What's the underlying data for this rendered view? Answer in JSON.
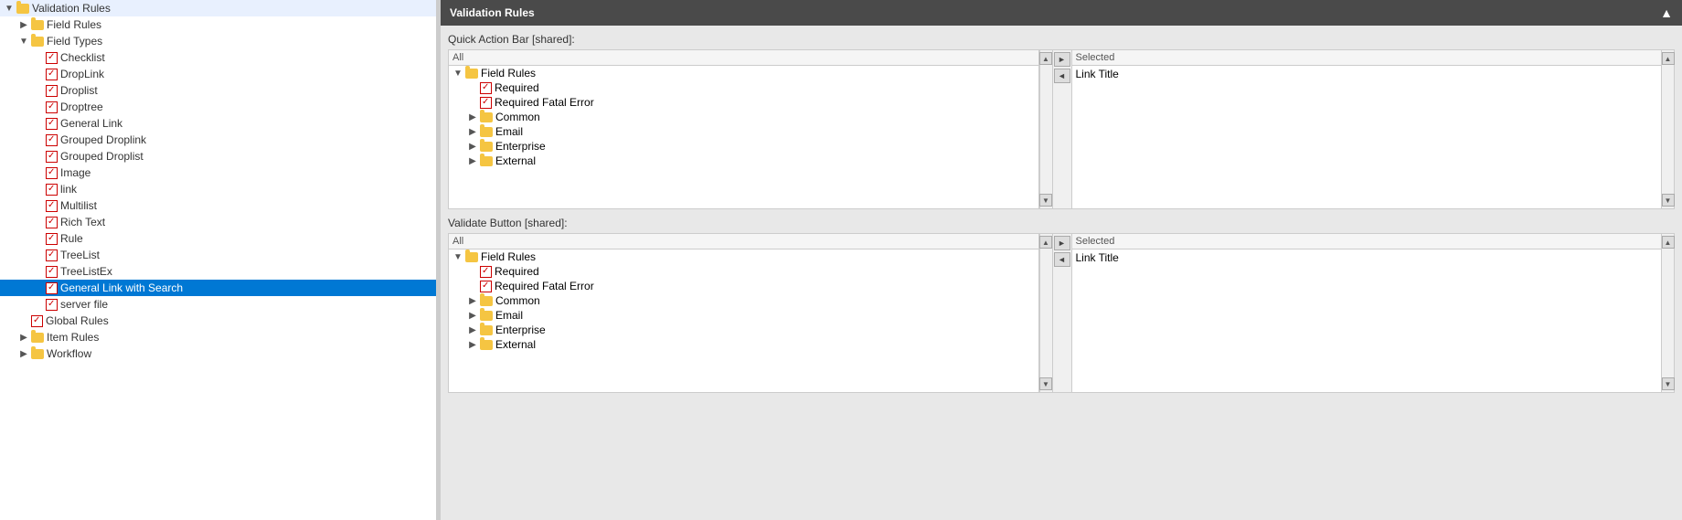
{
  "sidebar": {
    "title": "Validation Rules",
    "items": [
      {
        "id": "validation-rules",
        "label": "Validation Rules",
        "type": "folder",
        "level": 0,
        "expanded": true,
        "arrow": "open"
      },
      {
        "id": "field-rules",
        "label": "Field Rules",
        "type": "folder",
        "level": 1,
        "expanded": false,
        "arrow": "closed"
      },
      {
        "id": "field-types",
        "label": "Field Types",
        "type": "folder",
        "level": 1,
        "expanded": true,
        "arrow": "open"
      },
      {
        "id": "checklist",
        "label": "Checklist",
        "type": "rule",
        "level": 2,
        "arrow": "leaf"
      },
      {
        "id": "droplink",
        "label": "DropLink",
        "type": "rule",
        "level": 2,
        "arrow": "leaf"
      },
      {
        "id": "droplist",
        "label": "Droplist",
        "type": "rule",
        "level": 2,
        "arrow": "leaf"
      },
      {
        "id": "droptree",
        "label": "Droptree",
        "type": "rule",
        "level": 2,
        "arrow": "leaf"
      },
      {
        "id": "general-link",
        "label": "General Link",
        "type": "rule",
        "level": 2,
        "arrow": "leaf"
      },
      {
        "id": "grouped-droplink",
        "label": "Grouped Droplink",
        "type": "rule",
        "level": 2,
        "arrow": "leaf"
      },
      {
        "id": "grouped-droplist",
        "label": "Grouped Droplist",
        "type": "rule",
        "level": 2,
        "arrow": "leaf"
      },
      {
        "id": "image",
        "label": "Image",
        "type": "rule",
        "level": 2,
        "arrow": "leaf"
      },
      {
        "id": "link",
        "label": "link",
        "type": "rule",
        "level": 2,
        "arrow": "leaf"
      },
      {
        "id": "multilist",
        "label": "Multilist",
        "type": "rule",
        "level": 2,
        "arrow": "leaf"
      },
      {
        "id": "rich-text",
        "label": "Rich Text",
        "type": "rule",
        "level": 2,
        "arrow": "leaf"
      },
      {
        "id": "rule",
        "label": "Rule",
        "type": "rule",
        "level": 2,
        "arrow": "leaf"
      },
      {
        "id": "treelist",
        "label": "TreeList",
        "type": "rule",
        "level": 2,
        "arrow": "leaf"
      },
      {
        "id": "treelistex",
        "label": "TreeListEx",
        "type": "rule",
        "level": 2,
        "arrow": "leaf"
      },
      {
        "id": "general-link-search",
        "label": "General Link with Search",
        "type": "rule",
        "level": 2,
        "arrow": "leaf",
        "selected": true
      },
      {
        "id": "server-file",
        "label": "server file",
        "type": "rule",
        "level": 2,
        "arrow": "leaf"
      },
      {
        "id": "global-rules",
        "label": "Global Rules",
        "type": "rule",
        "level": 1,
        "arrow": "leaf"
      },
      {
        "id": "item-rules",
        "label": "Item Rules",
        "type": "folder",
        "level": 1,
        "expanded": false,
        "arrow": "closed"
      },
      {
        "id": "workflow",
        "label": "Workflow",
        "type": "folder",
        "level": 1,
        "expanded": false,
        "arrow": "closed"
      }
    ]
  },
  "panel": {
    "title": "Validation Rules",
    "collapse_label": "▲",
    "sections": [
      {
        "id": "quick-action-bar",
        "label": "Quick Action Bar",
        "shared": "[shared]:",
        "all_header": "All",
        "selected_header": "Selected",
        "selected_items": [
          "Link Title"
        ],
        "tree": {
          "items": [
            {
              "id": "field-rules-all-1",
              "label": "Field Rules",
              "type": "folder",
              "level": 0,
              "expanded": true
            },
            {
              "id": "required-1",
              "label": "Required",
              "type": "rule",
              "level": 1
            },
            {
              "id": "required-fatal-1",
              "label": "Required Fatal Error",
              "type": "rule",
              "level": 1
            },
            {
              "id": "common-1",
              "label": "Common",
              "type": "folder",
              "level": 1,
              "expanded": false
            },
            {
              "id": "email-1",
              "label": "Email",
              "type": "folder",
              "level": 1,
              "expanded": false
            },
            {
              "id": "enterprise-1",
              "label": "Enterprise",
              "type": "folder",
              "level": 1,
              "expanded": false
            },
            {
              "id": "external-1",
              "label": "External",
              "type": "folder",
              "level": 1,
              "expanded": false
            }
          ]
        }
      },
      {
        "id": "validate-button",
        "label": "Validate Button",
        "shared": "[shared]:",
        "all_header": "All",
        "selected_header": "Selected",
        "selected_items": [
          "Link Title"
        ],
        "tree": {
          "items": [
            {
              "id": "field-rules-all-2",
              "label": "Field Rules",
              "type": "folder",
              "level": 0,
              "expanded": true
            },
            {
              "id": "required-2",
              "label": "Required",
              "type": "rule",
              "level": 1
            },
            {
              "id": "required-fatal-2",
              "label": "Required Fatal Error",
              "type": "rule",
              "level": 1
            },
            {
              "id": "common-2",
              "label": "Common",
              "type": "folder",
              "level": 1,
              "expanded": false
            },
            {
              "id": "email-2",
              "label": "Email",
              "type": "folder",
              "level": 1,
              "expanded": false
            },
            {
              "id": "enterprise-2",
              "label": "Enterprise",
              "type": "folder",
              "level": 1,
              "expanded": false
            },
            {
              "id": "external-2",
              "label": "External",
              "type": "folder",
              "level": 1,
              "expanded": false
            }
          ]
        }
      }
    ],
    "controls": {
      "move_right": "►",
      "move_left": "◄",
      "scroll_up": "▲",
      "scroll_down": "▼"
    }
  }
}
